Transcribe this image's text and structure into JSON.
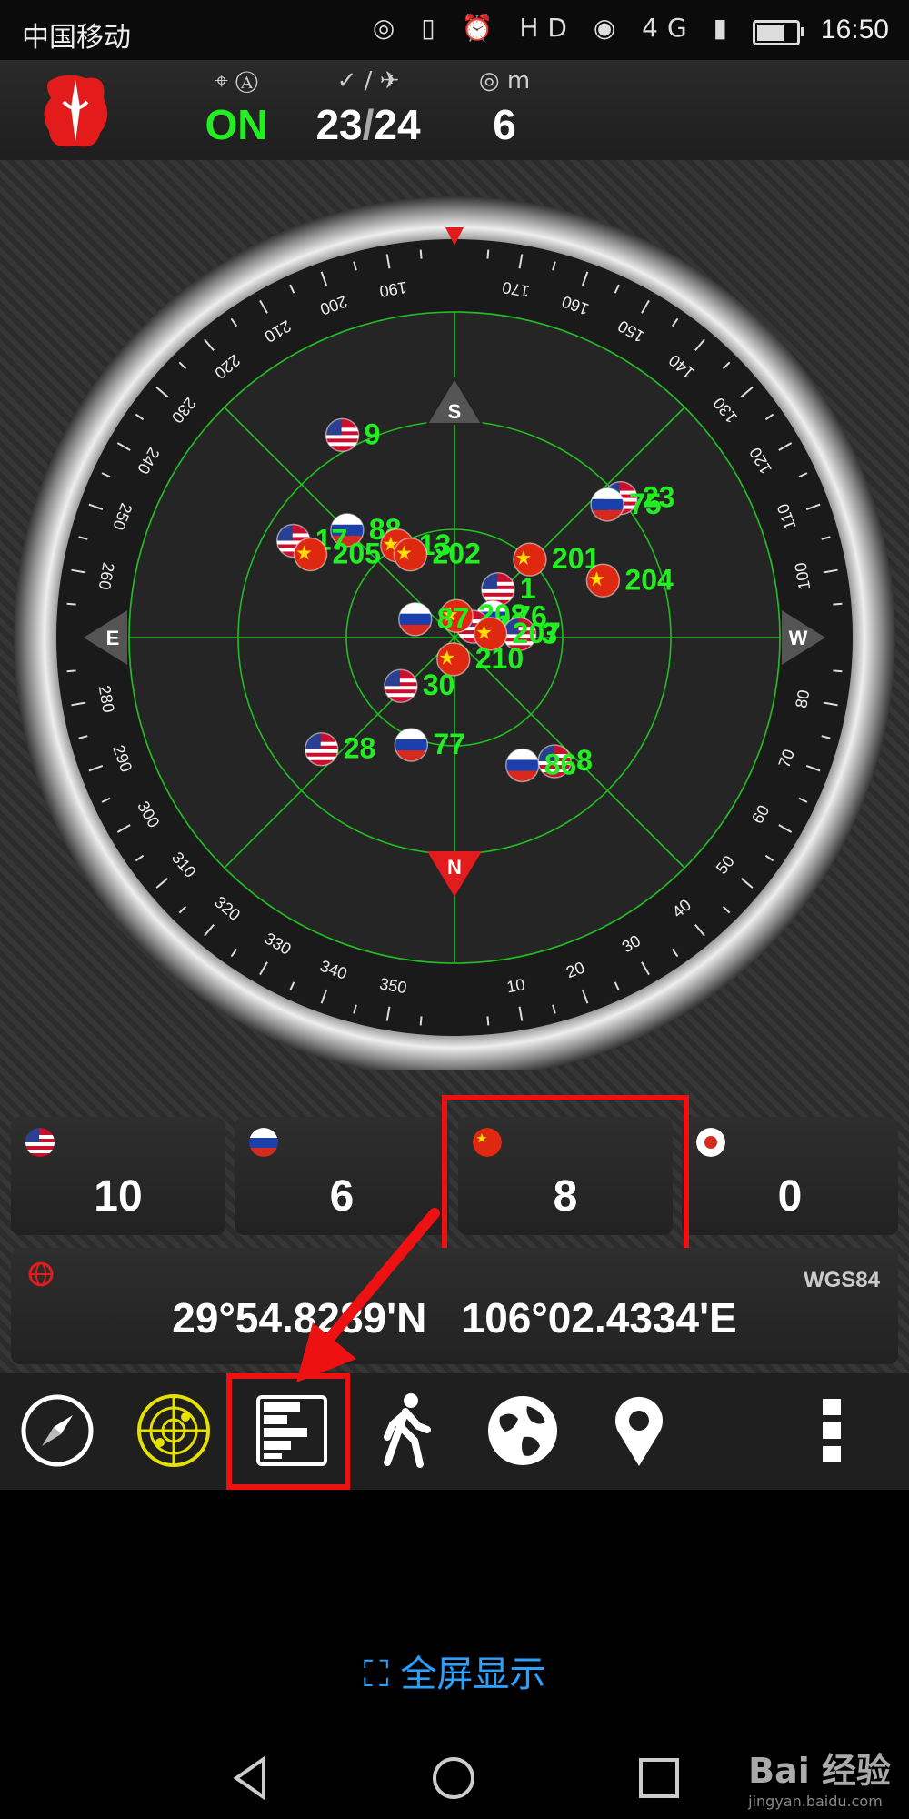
{
  "status_bar": {
    "carrier": "中国移动",
    "icons": "◎ ▯ ⏰ HD ◉ 4G ▮",
    "time": "16:50",
    "battery_level": 0.7
  },
  "top_bar": {
    "gps_status": "ON",
    "satellites_used": "23",
    "separator": "/",
    "satellites_visible": "24",
    "accuracy": "6",
    "accuracy_unit": "m",
    "icons": {
      "gps": "crosshair-icon",
      "check": "✓",
      "sat": "satellite-icon"
    }
  },
  "radar": {
    "marker_s": "S",
    "marker_n": "N",
    "marker_e": "E",
    "marker_w": "W",
    "satellites": [
      {
        "id": "9",
        "flag": "us",
        "az": 209,
        "el": 26
      },
      {
        "id": "88",
        "flag": "ru",
        "az": 225,
        "el": 48
      },
      {
        "id": "17",
        "flag": "us",
        "az": 239,
        "el": 38
      },
      {
        "id": "205",
        "flag": "cn",
        "az": 240,
        "el": 44
      },
      {
        "id": "13",
        "flag": "cn",
        "az": 212,
        "el": 60
      },
      {
        "id": "202",
        "flag": "cn",
        "az": 208,
        "el": 64
      },
      {
        "id": "23",
        "flag": "us",
        "az": 130,
        "el": 30
      },
      {
        "id": "75",
        "flag": "ru",
        "az": 131,
        "el": 34
      },
      {
        "id": "201",
        "flag": "cn",
        "az": 136,
        "el": 60
      },
      {
        "id": "1",
        "flag": "us",
        "az": 138,
        "el": 72
      },
      {
        "id": "204",
        "flag": "cn",
        "az": 111,
        "el": 46
      },
      {
        "id": "76",
        "flag": "ru",
        "az": 118,
        "el": 78
      },
      {
        "id": "11",
        "flag": "us",
        "az": 120,
        "el": 84
      },
      {
        "id": "208",
        "flag": "cn",
        "az": 175,
        "el": 84
      },
      {
        "id": "87",
        "flag": "ru",
        "az": 245,
        "el": 78
      },
      {
        "id": "3",
        "flag": "us",
        "az": 93,
        "el": 72
      },
      {
        "id": "207",
        "flag": "cn",
        "az": 96,
        "el": 80
      },
      {
        "id": "210",
        "flag": "cn",
        "az": 357,
        "el": 84
      },
      {
        "id": "30",
        "flag": "us",
        "az": 312,
        "el": 70
      },
      {
        "id": "28",
        "flag": "us",
        "az": 310,
        "el": 42
      },
      {
        "id": "77",
        "flag": "ru",
        "az": 338,
        "el": 58
      },
      {
        "id": "8",
        "flag": "us",
        "az": 39,
        "el": 46
      },
      {
        "id": "86",
        "flag": "ru",
        "az": 28,
        "el": 50
      }
    ]
  },
  "counts": [
    {
      "system": "gps",
      "flag": "us",
      "value": "10"
    },
    {
      "system": "glonass",
      "flag": "ru",
      "value": "6"
    },
    {
      "system": "beidou",
      "flag": "cn",
      "value": "8"
    },
    {
      "system": "other",
      "flag": "jp",
      "value": "0"
    }
  ],
  "position": {
    "datum": "WGS84",
    "latitude": "29°54.8289'N",
    "longitude": "106°02.4334'E"
  },
  "toolbar": [
    "compass-icon",
    "radar-icon",
    "signal-bars-icon",
    "walk-icon",
    "globe-icon",
    "map-pin-icon",
    "more-icon"
  ],
  "fullscreen_label": "全屏显示",
  "watermark": {
    "brand": "Bai 经验",
    "url": "jingyan.baidu.com"
  },
  "colors": {
    "accent_green": "#22ee22",
    "highlight_red": "#ee1111",
    "link_blue": "#2aa0ff"
  }
}
